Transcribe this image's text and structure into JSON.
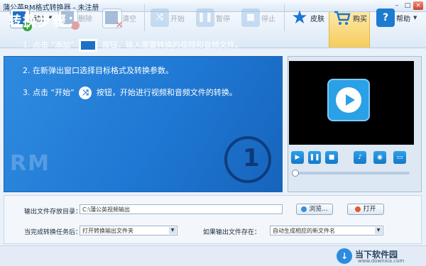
{
  "window": {
    "title": "蒲公英RM格式转换器 - 未注册",
    "minimize": "–",
    "maximize": "□",
    "close": "×"
  },
  "toolbar": {
    "add": "添加",
    "delete": "删除",
    "clear": "清空",
    "start": "开始",
    "pause": "暂停",
    "stop": "停止",
    "skin": "皮肤",
    "buy": "购买",
    "help": "帮助"
  },
  "guide": {
    "title": "转换步骤：",
    "step1_pre": "1. 点击 “添加”",
    "step1_post": "按钮，输入需要转换的视频和音频文件。",
    "step2": "2. 在新弹出窗口选择目标格式及转换参数。",
    "step3_pre": "3. 点击 “开始”",
    "step3_post": "按钮，开始进行视频和音频文件的转换。",
    "watermark": "RM",
    "badge": "1"
  },
  "player": {
    "buttons": [
      "play",
      "pause",
      "stop",
      "volume",
      "snapshot",
      "fullscreen"
    ],
    "seek_position": 0
  },
  "settings": {
    "output_dir_label": "输出文件存放目录：",
    "output_dir_value": "C:\\蒲公英视频输出",
    "browse": "浏览...",
    "open": "打开",
    "after_done_label": "当完成转换任务后：",
    "after_done_value": "打开转换输出文件夹",
    "if_exists_label": "如果输出文件存在：",
    "if_exists_value": "自动生成相应的新文件名"
  },
  "watermark_logo": {
    "name": "当下软件园",
    "url": "www.downxia.com"
  },
  "colors": {
    "accent": "#1f78d3",
    "buy_highlight": "#f6cc5b"
  }
}
